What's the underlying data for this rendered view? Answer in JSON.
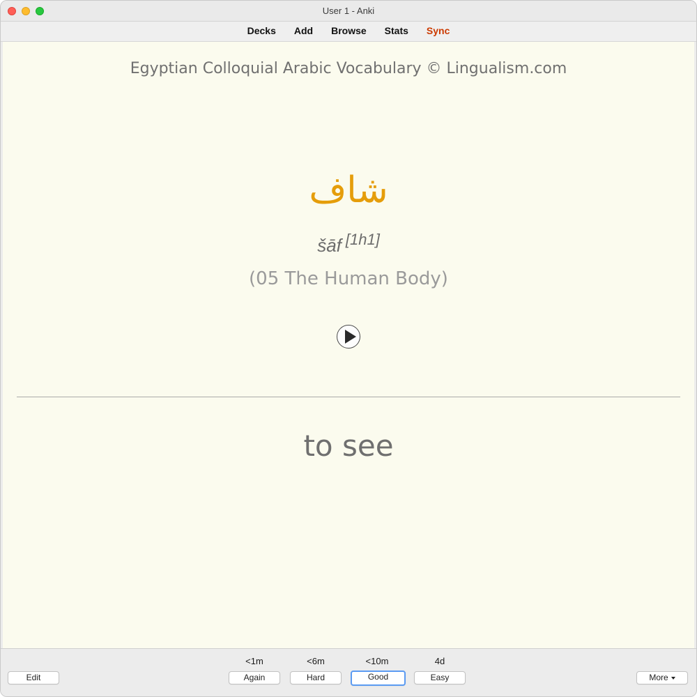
{
  "window": {
    "title": "User 1 - Anki"
  },
  "toolbar": {
    "decks": "Decks",
    "add": "Add",
    "browse": "Browse",
    "stats": "Stats",
    "sync": "Sync",
    "sync_color": "#cc3a00"
  },
  "card": {
    "deck_title": "Egyptian Colloquial Arabic Vocabulary © Lingualism.com",
    "arabic_word": "شاف",
    "arabic_color": "#e59d0a",
    "transliteration": "šāf",
    "verb_class": "[1h1]",
    "category": "(05 The Human Body)",
    "audio_icon": "play-icon",
    "answer": "to see",
    "background_color": "#fbfbee"
  },
  "bottombar": {
    "edit_label": "Edit",
    "more_label": "More",
    "answers": [
      {
        "interval": "<1m",
        "label": "Again"
      },
      {
        "interval": "<6m",
        "label": "Hard"
      },
      {
        "interval": "<10m",
        "label": "Good"
      },
      {
        "interval": "4d",
        "label": "Easy"
      }
    ],
    "focused_button": "Good",
    "focus_color": "#5b9bf2"
  }
}
